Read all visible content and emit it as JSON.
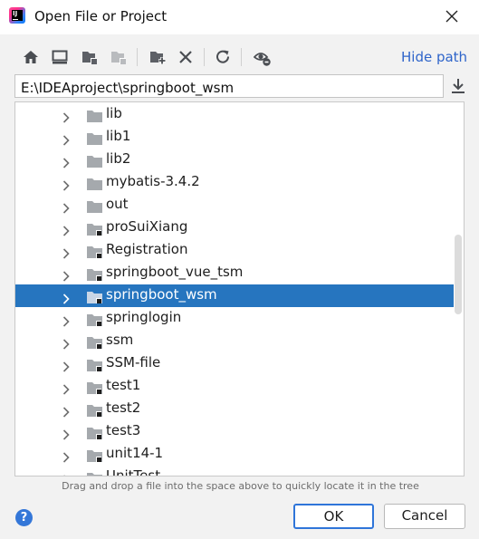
{
  "window": {
    "title": "Open File or Project",
    "app_icon": "intellij-idea-icon"
  },
  "toolbar": {
    "buttons": [
      {
        "name": "home-icon"
      },
      {
        "name": "desktop-icon"
      },
      {
        "name": "project-folder-icon"
      },
      {
        "name": "module-folder-icon"
      },
      {
        "name": "new-folder-icon"
      },
      {
        "name": "delete-icon"
      },
      {
        "name": "refresh-icon"
      },
      {
        "name": "show-hidden-icon"
      }
    ],
    "hide_path_label": "Hide path"
  },
  "path": {
    "value": "E:\\IDEAproject\\springboot_wsm"
  },
  "tree": {
    "items": [
      {
        "label": "lib",
        "marked": false,
        "selected": false
      },
      {
        "label": "lib1",
        "marked": false,
        "selected": false
      },
      {
        "label": "lib2",
        "marked": false,
        "selected": false
      },
      {
        "label": "mybatis-3.4.2",
        "marked": false,
        "selected": false
      },
      {
        "label": "out",
        "marked": false,
        "selected": false
      },
      {
        "label": "proSuiXiang",
        "marked": true,
        "selected": false
      },
      {
        "label": "Registration",
        "marked": true,
        "selected": false
      },
      {
        "label": "springboot_vue_tsm",
        "marked": true,
        "selected": false
      },
      {
        "label": "springboot_wsm",
        "marked": true,
        "selected": true
      },
      {
        "label": "springlogin",
        "marked": true,
        "selected": false
      },
      {
        "label": "ssm",
        "marked": true,
        "selected": false
      },
      {
        "label": "SSM-file",
        "marked": true,
        "selected": false
      },
      {
        "label": "test1",
        "marked": true,
        "selected": false
      },
      {
        "label": "test2",
        "marked": true,
        "selected": false
      },
      {
        "label": "test3",
        "marked": true,
        "selected": false
      },
      {
        "label": "unit14-1",
        "marked": true,
        "selected": false
      },
      {
        "label": "UnitTest",
        "marked": true,
        "selected": false
      }
    ]
  },
  "hint": "Drag and drop a file into the space above to quickly locate it in the tree",
  "footer": {
    "help_label": "?",
    "ok_label": "OK",
    "cancel_label": "Cancel"
  },
  "colors": {
    "selection": "#2675bf",
    "link": "#2f65ca",
    "ok_border": "#2f75d9",
    "folder": "#a5a9ad"
  }
}
